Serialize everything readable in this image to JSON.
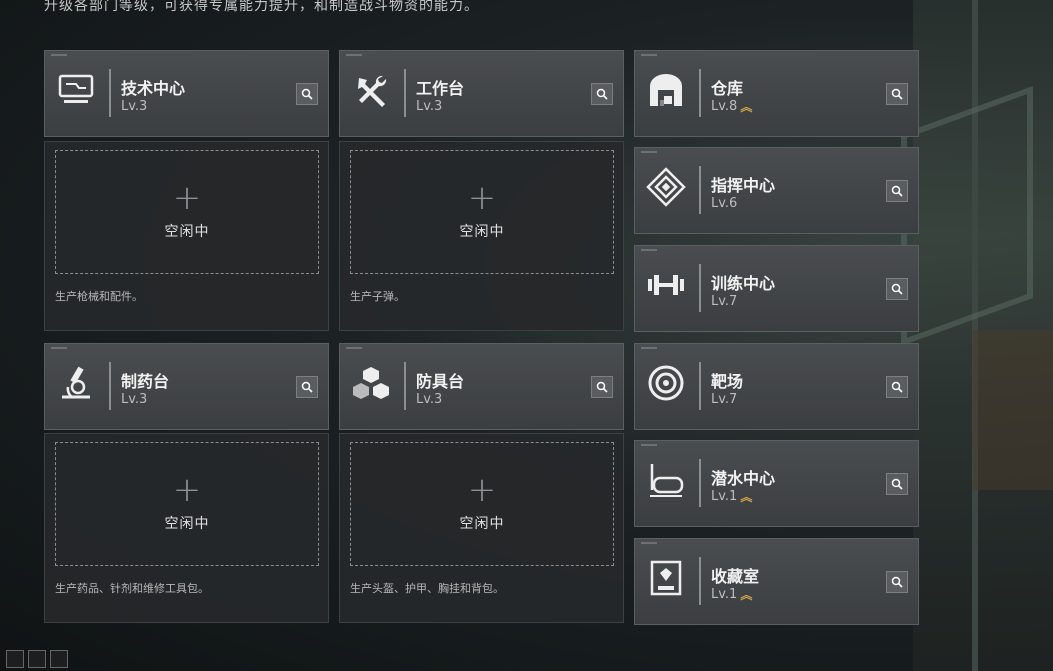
{
  "top_text": "升级各部门等级，可获得专属能力提升，和制造战斗物资的能力。",
  "left_stations": [
    {
      "name": "技术中心",
      "level": "Lv.3",
      "icon": "tech-center-icon",
      "idle": "空闲中",
      "desc": "生产枪械和配件。"
    },
    {
      "name": "工作台",
      "level": "Lv.3",
      "icon": "hammer-wrench-icon",
      "idle": "空闲中",
      "desc": "生产子弹。"
    },
    {
      "name": "制药台",
      "level": "Lv.3",
      "icon": "microscope-icon",
      "idle": "空闲中",
      "desc": "生产药品、针剂和维修工具包。"
    },
    {
      "name": "防具台",
      "level": "Lv.3",
      "icon": "cubes-icon",
      "idle": "空闲中",
      "desc": "生产头盔、护甲、胸挂和背包。"
    }
  ],
  "right_stations": [
    {
      "name": "仓库",
      "level": "Lv.8",
      "icon": "warehouse-icon",
      "upgrade": true
    },
    {
      "name": "指挥中心",
      "level": "Lv.6",
      "icon": "command-center-icon",
      "upgrade": false
    },
    {
      "name": "训练中心",
      "level": "Lv.7",
      "icon": "dumbbell-icon",
      "upgrade": false
    },
    {
      "name": "靶场",
      "level": "Lv.7",
      "icon": "target-icon",
      "upgrade": false
    },
    {
      "name": "潜水中心",
      "level": "Lv.1",
      "icon": "diving-mask-icon",
      "upgrade": true
    },
    {
      "name": "收藏室",
      "level": "Lv.1",
      "icon": "display-case-icon",
      "upgrade": true
    }
  ],
  "colors": {
    "accent_gold": "#c9a14a",
    "header_bg": "#414446",
    "panel_bg": "#26282a"
  }
}
